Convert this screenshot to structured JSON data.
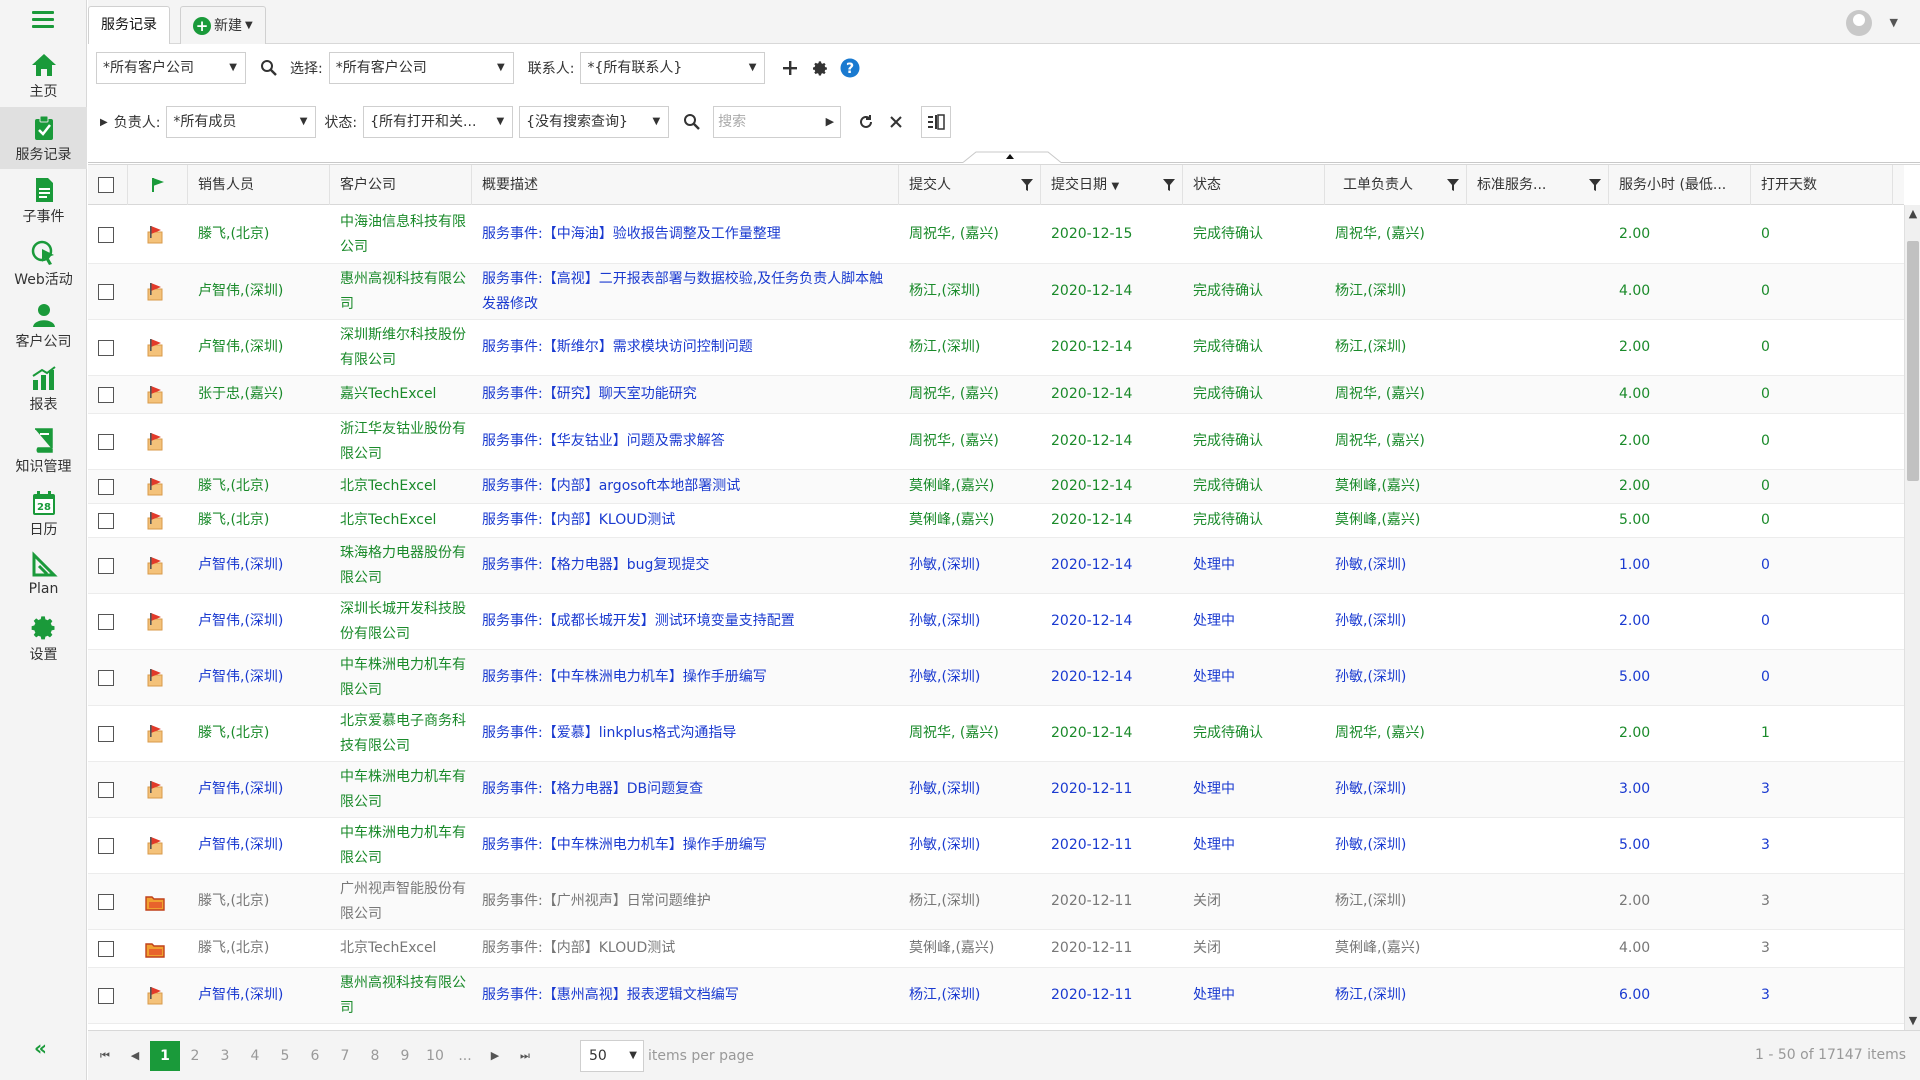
{
  "sidebar": {
    "items": [
      {
        "label": "主页",
        "icon": "home-icon"
      },
      {
        "label": "服务记录",
        "icon": "clipboard-check-icon",
        "active": true
      },
      {
        "label": "子事件",
        "icon": "document-icon"
      },
      {
        "label": "Web活动",
        "icon": "cursor-click-icon"
      },
      {
        "label": "客户公司",
        "icon": "user-icon"
      },
      {
        "label": "报表",
        "icon": "bar-chart-icon"
      },
      {
        "label": "知识管理",
        "icon": "book-icon"
      },
      {
        "label": "日历",
        "icon": "calendar-icon",
        "badge": "28"
      },
      {
        "label": "Plan",
        "icon": "plan-icon"
      },
      {
        "label": "设置",
        "icon": "gear-icon"
      }
    ],
    "collapse": "«"
  },
  "tabs": {
    "active_label": "服务记录",
    "new_label": "新建"
  },
  "filters1": {
    "company_value": "*所有客户公司",
    "select_label": "选择:",
    "select_value": "*所有客户公司",
    "contact_label": "联系人:",
    "contact_value": "*{所有联系人}"
  },
  "filters2": {
    "owner_label": "负责人:",
    "owner_value": "*所有成员",
    "status_label": "状态:",
    "status_value": "{所有打开和关...",
    "query_value": "{没有搜索查询}",
    "search_placeholder": "搜索"
  },
  "table": {
    "headers": [
      "销售人员",
      "客户公司",
      "概要描述",
      "提交人",
      "提交日期",
      "状态",
      "工单负责人",
      "标准服务...",
      "服务小时 (最低...",
      "打开天数"
    ],
    "sort_indicator": "▼",
    "rows": [
      {
        "sales": "滕飞,(北京)",
        "company": "中海油信息科技有限公司",
        "desc": "服务事件:【中海油】验收报告调整及工作量整理",
        "submitter": "周祝华, (嘉兴)",
        "date": "2020-12-15",
        "status": "完成待确认",
        "owner": "周祝华, (嘉兴)",
        "std": "",
        "hours": "2.00",
        "days": "0",
        "tone": "green",
        "icon": "flag"
      },
      {
        "sales": "卢智伟,(深圳)",
        "company": "惠州高视科技有限公司",
        "desc": "服务事件:【高视】二开报表部署与数据校验,及任务负责人脚本触发器修改",
        "submitter": "杨江,(深圳)",
        "date": "2020-12-14",
        "status": "完成待确认",
        "owner": "杨江,(深圳)",
        "std": "",
        "hours": "4.00",
        "days": "0",
        "tone": "green",
        "icon": "flag"
      },
      {
        "sales": "卢智伟,(深圳)",
        "company": "深圳斯维尔科技股份有限公司",
        "desc": "服务事件:【斯维尔】需求模块访问控制问题",
        "submitter": "杨江,(深圳)",
        "date": "2020-12-14",
        "status": "完成待确认",
        "owner": "杨江,(深圳)",
        "std": "",
        "hours": "2.00",
        "days": "0",
        "tone": "green",
        "icon": "flag"
      },
      {
        "sales": "张于忠,(嘉兴)",
        "company": "嘉兴TechExcel",
        "desc": "服务事件:【研究】聊天室功能研究",
        "submitter": "周祝华, (嘉兴)",
        "date": "2020-12-14",
        "status": "完成待确认",
        "owner": "周祝华, (嘉兴)",
        "std": "",
        "hours": "4.00",
        "days": "0",
        "tone": "green",
        "icon": "flag"
      },
      {
        "sales": "",
        "company": "浙江华友钴业股份有限公司",
        "desc": "服务事件:【华友钴业】问题及需求解答",
        "submitter": "周祝华, (嘉兴)",
        "date": "2020-12-14",
        "status": "完成待确认",
        "owner": "周祝华, (嘉兴)",
        "std": "",
        "hours": "2.00",
        "days": "0",
        "tone": "green",
        "icon": "flag"
      },
      {
        "sales": "滕飞,(北京)",
        "company": "北京TechExcel",
        "desc": "服务事件:【内部】argosoft本地部署测试",
        "submitter": "莫俐峰,(嘉兴)",
        "date": "2020-12-14",
        "status": "完成待确认",
        "owner": "莫俐峰,(嘉兴)",
        "std": "",
        "hours": "2.00",
        "days": "0",
        "tone": "green",
        "icon": "flag"
      },
      {
        "sales": "滕飞,(北京)",
        "company": "北京TechExcel",
        "desc": "服务事件:【内部】KLOUD测试",
        "submitter": "莫俐峰,(嘉兴)",
        "date": "2020-12-14",
        "status": "完成待确认",
        "owner": "莫俐峰,(嘉兴)",
        "std": "",
        "hours": "5.00",
        "days": "0",
        "tone": "green",
        "icon": "flag"
      },
      {
        "sales": "卢智伟,(深圳)",
        "company": "珠海格力电器股份有限公司",
        "desc": "服务事件:【格力电器】bug复现提交",
        "submitter": "孙敏,(深圳)",
        "date": "2020-12-14",
        "status": "处理中",
        "owner": "孙敏,(深圳)",
        "std": "",
        "hours": "1.00",
        "days": "0",
        "tone": "blue",
        "icon": "flag"
      },
      {
        "sales": "卢智伟,(深圳)",
        "company": "深圳长城开发科技股份有限公司",
        "desc": "服务事件:【成都长城开发】测试环境变量支持配置",
        "submitter": "孙敏,(深圳)",
        "date": "2020-12-14",
        "status": "处理中",
        "owner": "孙敏,(深圳)",
        "std": "",
        "hours": "2.00",
        "days": "0",
        "tone": "blue",
        "icon": "flag"
      },
      {
        "sales": "卢智伟,(深圳)",
        "company": "中车株洲电力机车有限公司",
        "desc": "服务事件:【中车株洲电力机车】操作手册编写",
        "submitter": "孙敏,(深圳)",
        "date": "2020-12-14",
        "status": "处理中",
        "owner": "孙敏,(深圳)",
        "std": "",
        "hours": "5.00",
        "days": "0",
        "tone": "blue",
        "icon": "flag"
      },
      {
        "sales": "滕飞,(北京)",
        "company": "北京爱慕电子商务科技有限公司",
        "desc": "服务事件:【爱慕】linkplus格式沟通指导",
        "submitter": "周祝华, (嘉兴)",
        "date": "2020-12-14",
        "status": "完成待确认",
        "owner": "周祝华, (嘉兴)",
        "std": "",
        "hours": "2.00",
        "days": "1",
        "tone": "green",
        "icon": "flag"
      },
      {
        "sales": "卢智伟,(深圳)",
        "company": "中车株洲电力机车有限公司",
        "desc": "服务事件:【格力电器】DB问题复查",
        "submitter": "孙敏,(深圳)",
        "date": "2020-12-11",
        "status": "处理中",
        "owner": "孙敏,(深圳)",
        "std": "",
        "hours": "3.00",
        "days": "3",
        "tone": "blue",
        "icon": "flag"
      },
      {
        "sales": "卢智伟,(深圳)",
        "company": "中车株洲电力机车有限公司",
        "desc": "服务事件:【中车株洲电力机车】操作手册编写",
        "submitter": "孙敏,(深圳)",
        "date": "2020-12-11",
        "status": "处理中",
        "owner": "孙敏,(深圳)",
        "std": "",
        "hours": "5.00",
        "days": "3",
        "tone": "blue",
        "icon": "flag"
      },
      {
        "sales": "滕飞,(北京)",
        "company": "广州视声智能股份有限公司",
        "desc": "服务事件:【广州视声】日常问题维护",
        "submitter": "杨江,(深圳)",
        "date": "2020-12-11",
        "status": "关闭",
        "owner": "杨江,(深圳)",
        "std": "",
        "hours": "2.00",
        "days": "3",
        "tone": "gray",
        "icon": "folder"
      },
      {
        "sales": "滕飞,(北京)",
        "company": "北京TechExcel",
        "desc": "服务事件:【内部】KLOUD测试",
        "submitter": "莫俐峰,(嘉兴)",
        "date": "2020-12-11",
        "status": "关闭",
        "owner": "莫俐峰,(嘉兴)",
        "std": "",
        "hours": "4.00",
        "days": "3",
        "tone": "gray",
        "icon": "folder"
      },
      {
        "sales": "卢智伟,(深圳)",
        "company": "惠州高视科技有限公司",
        "desc": "服务事件:【惠州高视】报表逻辑文档编写",
        "submitter": "杨江,(深圳)",
        "date": "2020-12-11",
        "status": "处理中",
        "owner": "杨江,(深圳)",
        "std": "",
        "hours": "6.00",
        "days": "3",
        "tone": "blue",
        "icon": "flag"
      }
    ]
  },
  "pager": {
    "pages": [
      "1",
      "2",
      "3",
      "4",
      "5",
      "6",
      "7",
      "8",
      "9",
      "10",
      "..."
    ],
    "current": "1",
    "per_page": "50",
    "per_page_label": "items per page",
    "info": "1 - 50 of 17147 items"
  },
  "colors": {
    "accent": "#1a9a3a",
    "link_blue": "#1a3ad0",
    "text_green": "#1a8a2a",
    "text_gray": "#777777"
  }
}
